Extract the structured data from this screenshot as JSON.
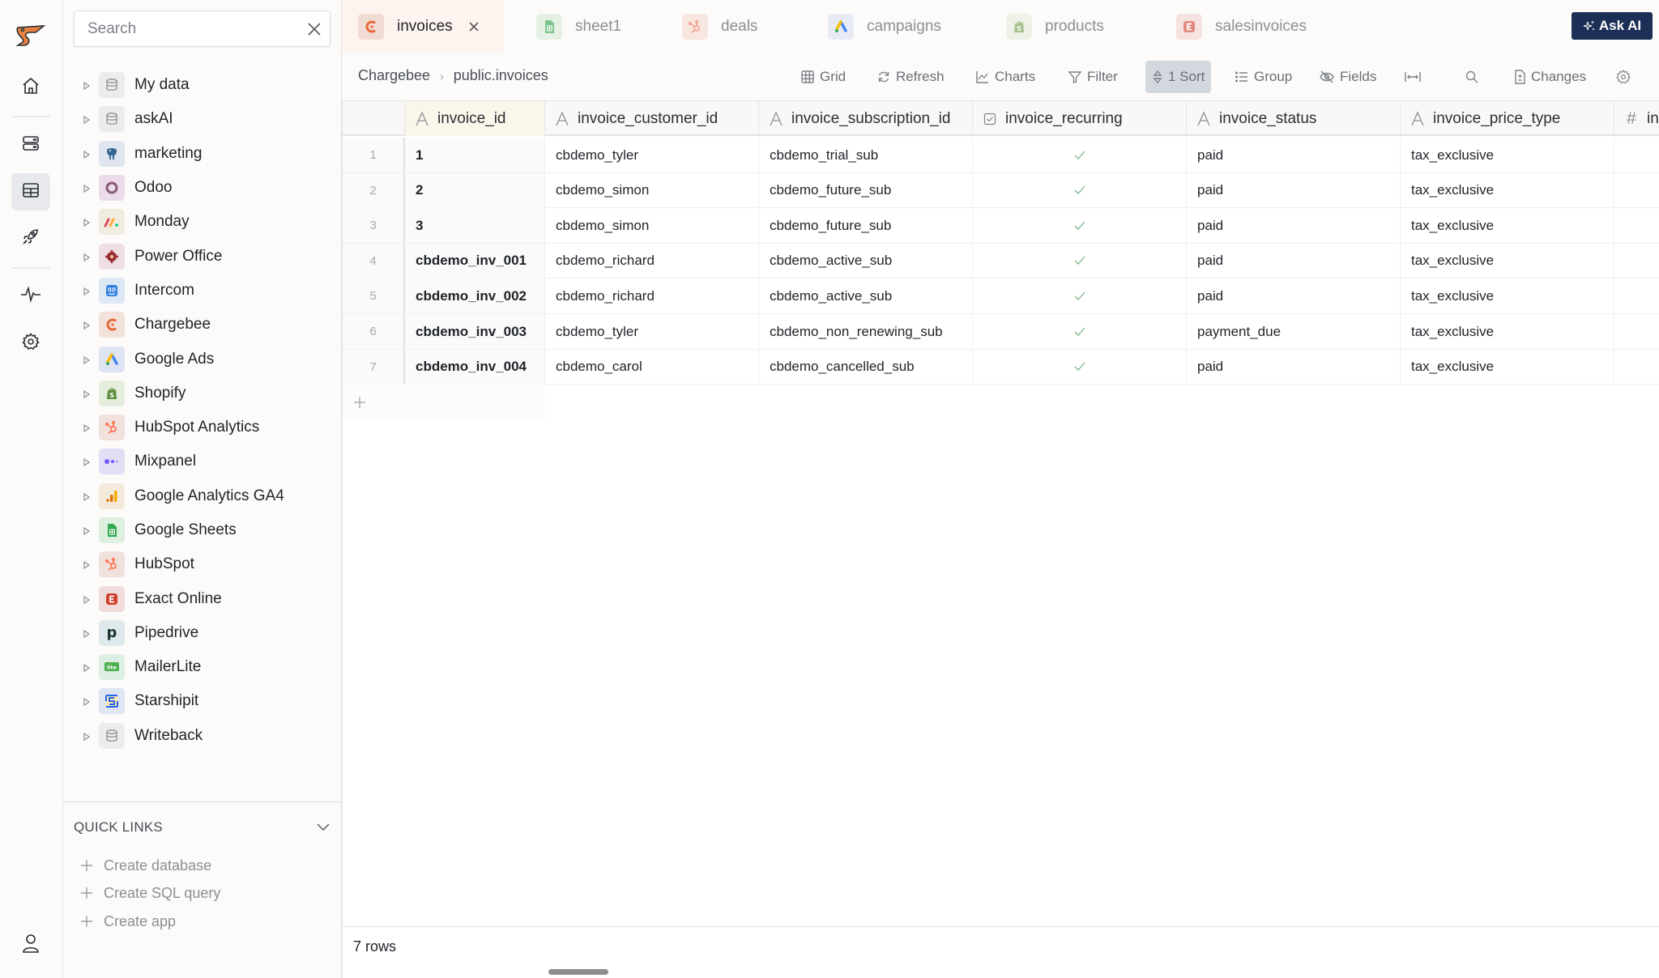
{
  "rail": {
    "logo": "pelican-logo",
    "items": [
      {
        "name": "home",
        "icon": "home-icon"
      },
      {
        "name": "databases",
        "icon": "server-icon"
      },
      {
        "name": "tables",
        "icon": "table-icon",
        "active": true
      },
      {
        "name": "launch",
        "icon": "rocket-icon"
      },
      {
        "name": "activity",
        "icon": "pulse-icon"
      },
      {
        "name": "settings",
        "icon": "gear-icon"
      }
    ],
    "user_icon": "user-icon"
  },
  "sidebar": {
    "search": {
      "placeholder": "Search",
      "value": ""
    },
    "tree": [
      {
        "label": "My data",
        "icon": "database-icon",
        "bg": "#ececec",
        "fg": "#8a8e94"
      },
      {
        "label": "askAI",
        "icon": "database-icon",
        "bg": "#ececec",
        "fg": "#8a8e94"
      },
      {
        "label": "marketing",
        "icon": "postgres-icon",
        "bg": "#dfe6ef",
        "fg": "#336791"
      },
      {
        "label": "Odoo",
        "icon": "odoo-icon",
        "bg": "#ecdce9",
        "fg": "#875a7b"
      },
      {
        "label": "Monday",
        "icon": "monday-icon",
        "bg": "#f1ece0",
        "fg": "#e2445c"
      },
      {
        "label": "Power Office",
        "icon": "poweroffice-icon",
        "bg": "#efdfe3",
        "fg": "#9c2e35"
      },
      {
        "label": "Intercom",
        "icon": "intercom-icon",
        "bg": "#dde8f5",
        "fg": "#2f7de1"
      },
      {
        "label": "Chargebee",
        "icon": "chargebee-icon",
        "bg": "#f3e1dc",
        "fg": "#e86a3a"
      },
      {
        "label": "Google Ads",
        "icon": "google-ads-icon",
        "bg": "#dfe4f3",
        "fg": "#f4b400"
      },
      {
        "label": "Shopify",
        "icon": "shopify-icon",
        "bg": "#e5eedc",
        "fg": "#5e8e3e"
      },
      {
        "label": "HubSpot Analytics",
        "icon": "hubspot-icon",
        "bg": "#f1e1dc",
        "fg": "#ff7a59"
      },
      {
        "label": "Mixpanel",
        "icon": "mixpanel-icon",
        "bg": "#e2def4",
        "fg": "#7856ff"
      },
      {
        "label": "Google Analytics GA4",
        "icon": "ga4-icon",
        "bg": "#f3eadb",
        "fg": "#e8a317"
      },
      {
        "label": "Google Sheets",
        "icon": "sheets-icon",
        "bg": "#ddefdf",
        "fg": "#34a853"
      },
      {
        "label": "HubSpot",
        "icon": "hubspot-icon",
        "bg": "#f1e1dc",
        "fg": "#ff7a59"
      },
      {
        "label": "Exact Online",
        "icon": "exact-icon",
        "bg": "#f0dcda",
        "fg": "#d13d2a"
      },
      {
        "label": "Pipedrive",
        "icon": "pipedrive-icon",
        "bg": "#dfe9ec",
        "fg": "#1a3330"
      },
      {
        "label": "MailerLite",
        "icon": "mailerlite-icon",
        "bg": "#ddefe3",
        "fg": "#4caf50"
      },
      {
        "label": "Starshipit",
        "icon": "starshipit-icon",
        "bg": "#dfe5f3",
        "fg": "#2563eb"
      },
      {
        "label": "Writeback",
        "icon": "database-icon",
        "bg": "#ececec",
        "fg": "#8a8e94"
      }
    ],
    "quick_links": {
      "title": "QUICK LINKS",
      "items": [
        "Create database",
        "Create SQL query",
        "Create app"
      ]
    }
  },
  "tabs": [
    {
      "label": "invoices",
      "icon": "chargebee-icon",
      "bg": "#f1dcd4",
      "fg": "#e86a3a",
      "active": true,
      "closable": true
    },
    {
      "label": "sheet1",
      "icon": "sheets-icon",
      "bg": "#e6f1e6",
      "fg": "#7cc48a"
    },
    {
      "label": "deals",
      "icon": "hubspot-icon",
      "bg": "#f8e6e1",
      "fg": "#f2a893"
    },
    {
      "label": "campaigns",
      "icon": "google-ads-icon",
      "bg": "#e8ebf5",
      "fg": "#8da7e0"
    },
    {
      "label": "products",
      "icon": "shopify-icon",
      "bg": "#eef2e6",
      "fg": "#a6c28d"
    },
    {
      "label": "salesinvoices",
      "icon": "exact-icon",
      "bg": "#f6e2e0",
      "fg": "#e1897e"
    }
  ],
  "ask_ai": {
    "label": "Ask AI",
    "bg": "#1b2f57"
  },
  "breadcrumb": {
    "source": "Chargebee",
    "table": "public.invoices"
  },
  "toolbar": [
    {
      "label": "Grid",
      "icon": "grid-icon"
    },
    {
      "label": "Refresh",
      "icon": "refresh-icon"
    },
    {
      "label": "Charts",
      "icon": "chart-icon"
    },
    {
      "label": "Filter",
      "icon": "filter-icon"
    },
    {
      "label": "1 Sort",
      "icon": "sort-icon",
      "active": true
    },
    {
      "label": "Group",
      "icon": "list-icon"
    },
    {
      "label": "Fields",
      "icon": "eye-off-icon"
    },
    {
      "label": "",
      "icon": "fit-width-icon"
    },
    {
      "label": "",
      "icon": "search-icon"
    },
    {
      "label": "Changes",
      "icon": "file-diff-icon"
    },
    {
      "label": "",
      "icon": "gear-icon"
    }
  ],
  "table": {
    "columns": [
      {
        "name": "invoice_id",
        "type": "text",
        "sorted": true
      },
      {
        "name": "invoice_customer_id",
        "type": "text"
      },
      {
        "name": "invoice_subscription_id",
        "type": "text"
      },
      {
        "name": "invoice_recurring",
        "type": "boolean"
      },
      {
        "name": "invoice_status",
        "type": "text"
      },
      {
        "name": "invoice_price_type",
        "type": "text"
      },
      {
        "name": "in",
        "type": "number"
      }
    ],
    "rows": [
      {
        "n": "1",
        "cells": [
          "1",
          "cbdemo_tyler",
          "cbdemo_trial_sub",
          true,
          "paid",
          "tax_exclusive",
          ""
        ]
      },
      {
        "n": "2",
        "cells": [
          "2",
          "cbdemo_simon",
          "cbdemo_future_sub",
          true,
          "paid",
          "tax_exclusive",
          ""
        ]
      },
      {
        "n": "3",
        "cells": [
          "3",
          "cbdemo_simon",
          "cbdemo_future_sub",
          true,
          "paid",
          "tax_exclusive",
          ""
        ]
      },
      {
        "n": "4",
        "cells": [
          "cbdemo_inv_001",
          "cbdemo_richard",
          "cbdemo_active_sub",
          true,
          "paid",
          "tax_exclusive",
          ""
        ]
      },
      {
        "n": "5",
        "cells": [
          "cbdemo_inv_002",
          "cbdemo_richard",
          "cbdemo_active_sub",
          true,
          "paid",
          "tax_exclusive",
          ""
        ]
      },
      {
        "n": "6",
        "cells": [
          "cbdemo_inv_003",
          "cbdemo_tyler",
          "cbdemo_non_renewing_sub",
          true,
          "payment_due",
          "tax_exclusive",
          ""
        ]
      },
      {
        "n": "7",
        "cells": [
          "cbdemo_inv_004",
          "cbdemo_carol",
          "cbdemo_cancelled_sub",
          true,
          "paid",
          "tax_exclusive",
          ""
        ]
      }
    ],
    "check_color": "#7fb88a"
  },
  "status": {
    "row_count": "7 rows"
  }
}
